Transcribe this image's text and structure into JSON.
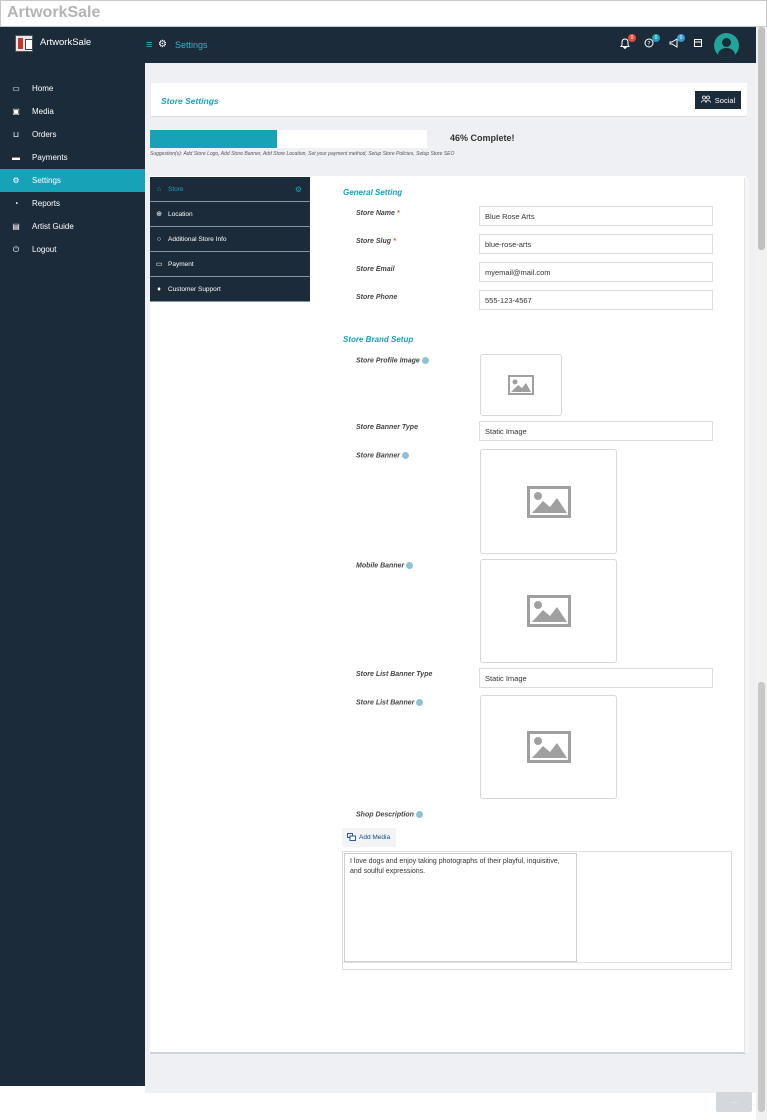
{
  "window": {
    "title": "ArtworkSale"
  },
  "header": {
    "brand": "ArtworkSale",
    "breadcrumb": "Settings",
    "notifications": [
      {
        "icon": "bell-icon",
        "badge": "0",
        "color": "#e74c3c"
      },
      {
        "icon": "help-circle-icon",
        "badge": "0",
        "color": "#17a2b8"
      },
      {
        "icon": "megaphone-icon",
        "badge": "0",
        "color": "#3498db"
      }
    ]
  },
  "sidebar": {
    "items": [
      {
        "label": "Home",
        "icon": "monitor-icon"
      },
      {
        "label": "Media",
        "icon": "image-icon"
      },
      {
        "label": "Orders",
        "icon": "cart-icon"
      },
      {
        "label": "Payments",
        "icon": "credit-card-icon"
      },
      {
        "label": "Settings",
        "icon": "gears-icon",
        "active": true
      },
      {
        "label": "Reports",
        "icon": "pie-chart-icon"
      },
      {
        "label": "Artist Guide",
        "icon": "book-icon"
      },
      {
        "label": "Logout",
        "icon": "power-icon"
      }
    ]
  },
  "panel": {
    "title": "Store Settings",
    "social_button": "Social"
  },
  "progress": {
    "percent": 46,
    "label": "46% Complete!",
    "suggestion": "Suggestion(s): Add Store Logo, Add Store Banner, Add Store Location, Set your payment method, Setup Store Policies, Setup Store SEO"
  },
  "tabs": [
    {
      "label": "Store",
      "active": true
    },
    {
      "label": "Location"
    },
    {
      "label": "Additional Store Info"
    },
    {
      "label": "Payment"
    },
    {
      "label": "Customer Support"
    }
  ],
  "general": {
    "title": "General Setting",
    "fields": [
      {
        "label": "Store Name",
        "required": "*",
        "value": "Blue Rose Arts"
      },
      {
        "label": "Store Slug",
        "required": "*",
        "value": "blue-rose-arts"
      },
      {
        "label": "Store Email",
        "value": "myemail@mail.com"
      },
      {
        "label": "Store Phone",
        "value": "555-123-4567"
      }
    ]
  },
  "brand": {
    "title": "Store Brand Setup",
    "profile_image_label": "Store Profile Image",
    "banner_type_label": "Store Banner Type",
    "banner_type_value": "Static Image",
    "banner_label": "Store Banner",
    "mobile_banner_label": "Mobile Banner",
    "list_banner_type_label": "Store List Banner Type",
    "list_banner_type_value": "Static Image",
    "list_banner_label": "Store List Banner",
    "description_label": "Shop Description",
    "add_media": "Add Media",
    "description": "I love dogs and enjoy taking photographs of their playful, inquisitive, and soulful expressions."
  }
}
